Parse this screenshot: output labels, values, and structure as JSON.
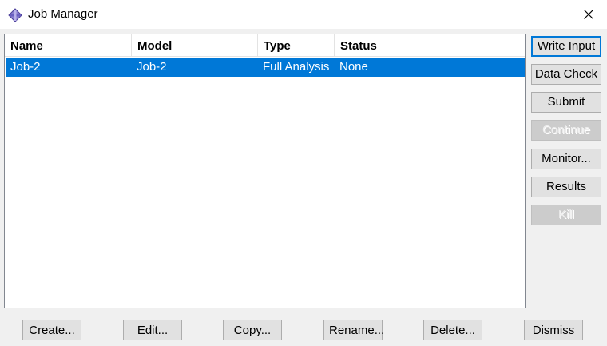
{
  "window": {
    "title": "Job Manager",
    "icon": "abaqus-diamond-icon",
    "close_icon": "close-icon"
  },
  "table": {
    "columns": [
      "Name",
      "Model",
      "Type",
      "Status"
    ],
    "rows": [
      {
        "name": "Job-2",
        "model": "Job-2",
        "type": "Full Analysis",
        "status": "None",
        "selected": true
      }
    ]
  },
  "side_buttons": {
    "write_input": "Write Input",
    "data_check": "Data Check",
    "submit": "Submit",
    "continue": "Continue",
    "monitor": "Monitor...",
    "results": "Results",
    "kill": "Kill"
  },
  "bottom_buttons": {
    "create": "Create...",
    "edit": "Edit...",
    "copy": "Copy...",
    "rename": "Rename...",
    "delete": "Delete...",
    "dismiss": "Dismiss"
  },
  "colors": {
    "selection": "#0078d7",
    "default_border": "#0078d7",
    "button_bg": "#e1e1e1"
  }
}
